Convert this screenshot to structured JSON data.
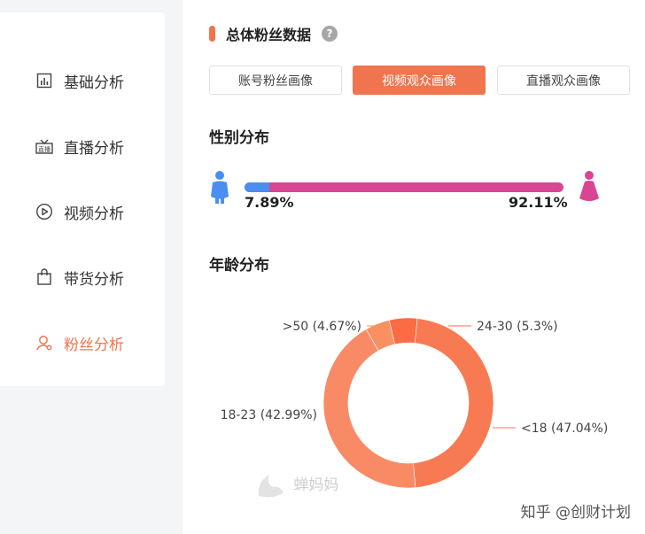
{
  "sidebar": {
    "items": [
      {
        "label": "基础分析",
        "icon": "bar-chart-icon"
      },
      {
        "label": "直播分析",
        "icon": "live-icon"
      },
      {
        "label": "视频分析",
        "icon": "play-icon"
      },
      {
        "label": "带货分析",
        "icon": "shopping-bag-icon"
      },
      {
        "label": "粉丝分析",
        "icon": "user-icon",
        "active": true
      }
    ]
  },
  "section": {
    "title": "总体粉丝数据",
    "help": "?"
  },
  "tabs": [
    {
      "label": "账号粉丝画像",
      "active": false
    },
    {
      "label": "视频观众画像",
      "active": true
    },
    {
      "label": "直播观众画像",
      "active": false
    }
  ],
  "gender": {
    "title": "性别分布",
    "male_label": "7.89%",
    "female_label": "92.11%",
    "male_fraction": 0.0789,
    "colors": {
      "male": "#4a8ff0",
      "female": "#d94593"
    }
  },
  "age": {
    "title": "年龄分布"
  },
  "chart_data": {
    "type": "pie",
    "title": "年龄分布",
    "donut": true,
    "slices": [
      {
        "label": "<18 (47.04%)",
        "category": "<18",
        "value": 47.04,
        "color": "#f87a52"
      },
      {
        "label": "18-23 (42.99%)",
        "category": "18-23",
        "value": 42.99,
        "color": "#f88a66"
      },
      {
        "label": ">50 (4.67%)",
        "category": ">50",
        "value": 4.67,
        "color": "#f89062"
      },
      {
        "label": "24-30 (5.3%)",
        "category": "24-30",
        "value": 5.3,
        "color": "#fb6b44"
      }
    ]
  },
  "watermark": {
    "text": "蝉妈妈"
  },
  "credit": {
    "text": "知乎 @创财计划"
  }
}
